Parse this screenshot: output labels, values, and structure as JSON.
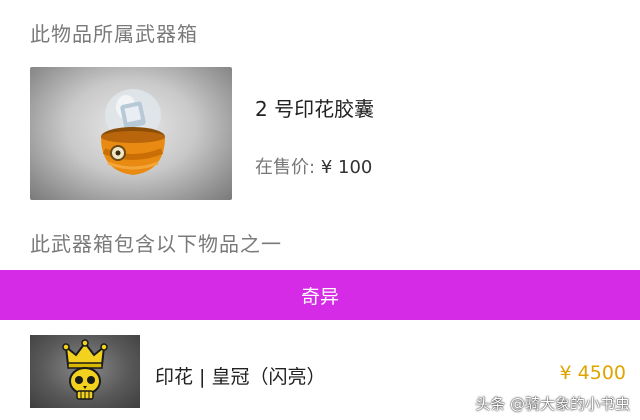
{
  "sections": {
    "belongs_title": "此物品所属武器箱",
    "contains_title": "此武器箱包含以下物品之一"
  },
  "case": {
    "name": "2 号印花胶囊",
    "price_label": "在售价:",
    "price_value": "¥ 100",
    "image_icon": "sticker-capsule-icon"
  },
  "rarity": {
    "label": "奇异",
    "color": "#d52be6"
  },
  "item": {
    "name": "印花 | 皇冠（闪亮）",
    "price": "¥ 4500",
    "price_color": "#e0a400",
    "image_icon": "crown-skull-sticker-icon"
  },
  "watermark": "头条 @骑大象的小书虫"
}
